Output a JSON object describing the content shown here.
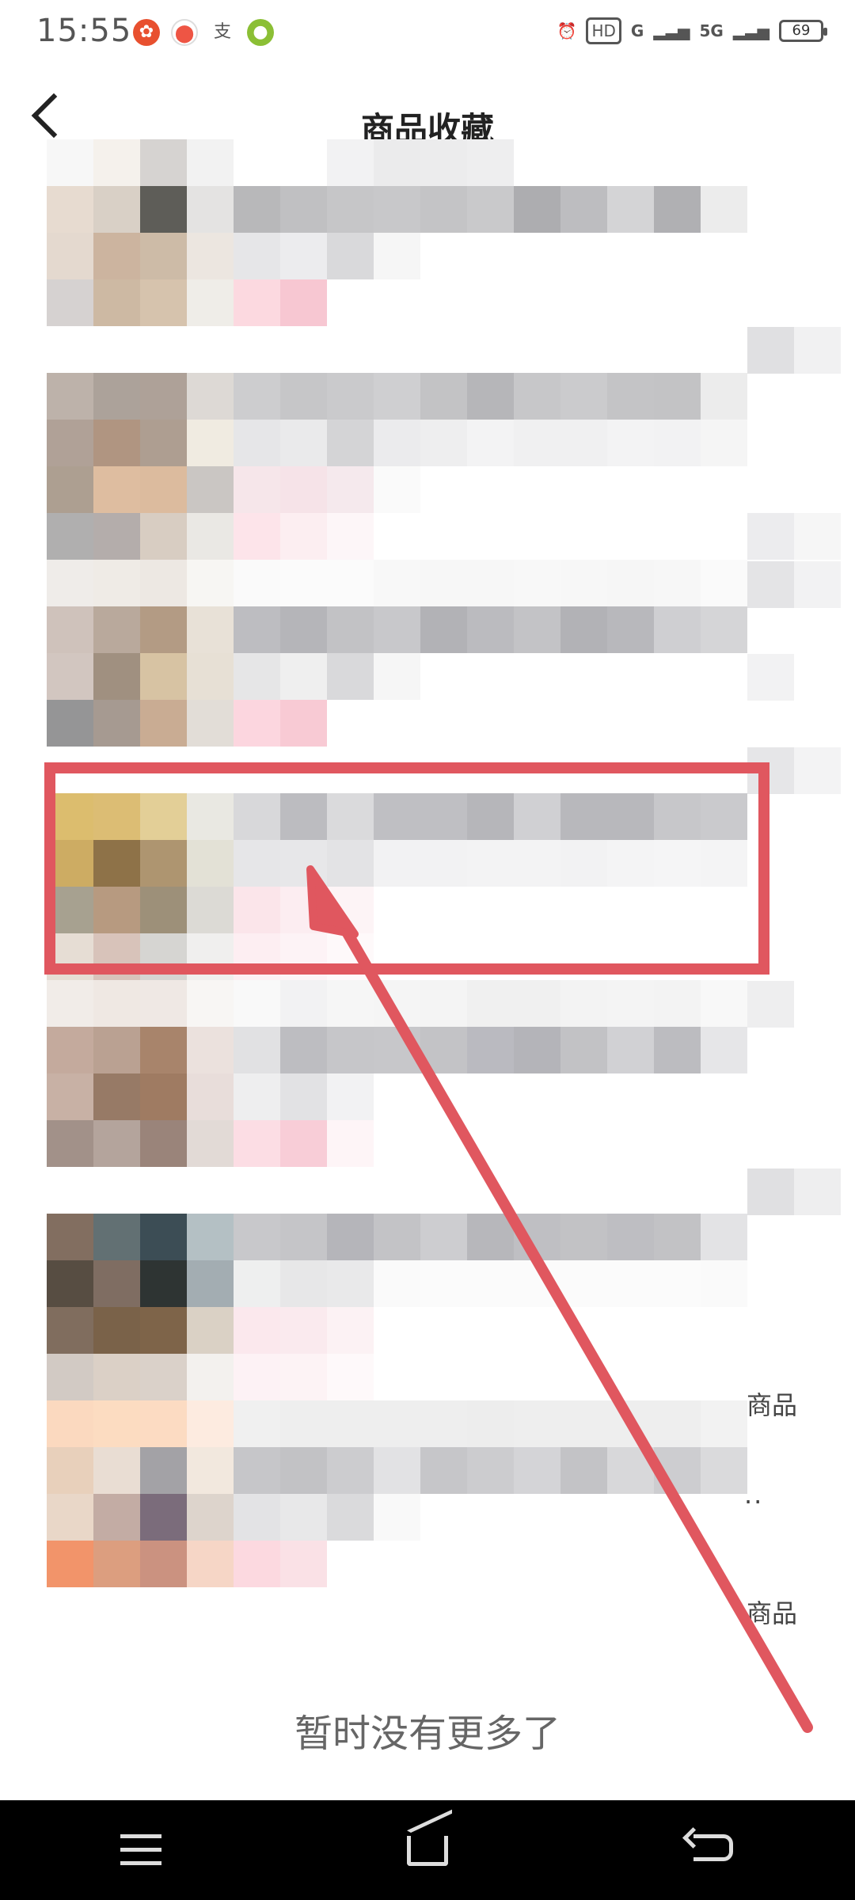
{
  "status_bar": {
    "time": "15:55",
    "battery": "69",
    "network": "5G",
    "hd_label": "HD",
    "signal_label": "G"
  },
  "header": {
    "title": "商品收藏"
  },
  "labels": {
    "right_label_1": "商品",
    "right_label_2": "商品",
    "ellipsis": "··"
  },
  "footer": {
    "no_more": "暂时没有更多了"
  },
  "colors": {
    "annotation": "#e0575f",
    "nav_bg": "#000000"
  }
}
